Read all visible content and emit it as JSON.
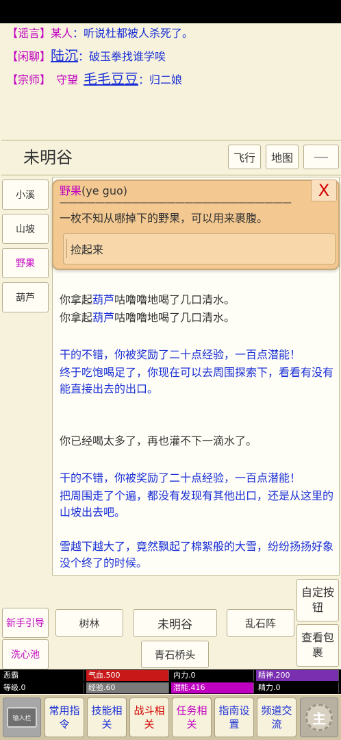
{
  "chat": [
    {
      "tag": "【谣言】",
      "speaker": "某人",
      "sep": "：",
      "message": "听说杜都被人杀死了。"
    },
    {
      "tag": "【闲聊】",
      "speaker": "陆沉",
      "sep": "：",
      "message": "破玉拳找谁学唉"
    },
    {
      "tag": "【宗师】",
      "title": "守望",
      "speaker": "毛毛豆豆",
      "sep": "：",
      "message": "归二娘"
    }
  ],
  "header": {
    "room_name": "未明谷",
    "fly_label": "飞行",
    "map_label": "地图",
    "minimize_symbol": "—"
  },
  "sidebar": {
    "items": [
      {
        "label": "小溪"
      },
      {
        "label": "山坡"
      },
      {
        "label": "野果"
      },
      {
        "label": "葫芦"
      }
    ],
    "bottom_items": [
      {
        "label": "新手引导"
      },
      {
        "label": "洗心池"
      }
    ]
  },
  "popup": {
    "item_name": "野果",
    "item_id": "(ye guo)",
    "rule": "——————————————————————————",
    "description": "一枚不知从哪掉下的野果，可以用来裹腹。",
    "close_label": "X",
    "action_label": "捡起来"
  },
  "log": [
    {
      "pre": "你拿起",
      "hl": "葫芦",
      "post": "咕噜噜地喝了几口清水。"
    },
    {
      "pre": "你拿起",
      "hl": "葫芦",
      "post": "咕噜噜地喝了几口清水。"
    },
    {
      "text": "干的不错，你被奖励了二十点经验，一百点潜能！"
    },
    {
      "text": "终于吃饱喝足了，你现在可以去周围探索下，看看有没有能直接出去的出口。"
    },
    {
      "text": "你已经喝太多了，再也灌不下一滴水了。"
    },
    {
      "text": "干的不错，你被奖励了二十点经验，一百点潜能！"
    },
    {
      "text": "把周围走了个遍，都没有发现有其他出口，还是从这里的山坡出去吧。"
    },
    {
      "text": "雪越下越大了，竟然飘起了棉絮般的大雪，纷纷扬扬好象没个终了的时候。"
    }
  ],
  "exits": {
    "west": "树林",
    "center": "未明谷",
    "east": "乱石阵",
    "south": "青石桥头"
  },
  "right_buttons": {
    "custom": "自定按钮",
    "inventory": "查看包裹"
  },
  "stats": {
    "row1": [
      {
        "label": "恶霸",
        "color": "#000000",
        "fill": 1.0
      },
      {
        "label": "气血.500",
        "color": "#c81818",
        "fill": 1.0
      },
      {
        "label": "内力.0",
        "color": "#000000",
        "fill": 0.0
      },
      {
        "label": "精神.200",
        "color": "#7a2fb0",
        "fill": 1.0
      }
    ],
    "row2": [
      {
        "label": "等级.0",
        "color": "#000000",
        "fill": 0.0
      },
      {
        "label": "经验.60",
        "color": "#7a7a7a",
        "fill": 1.0
      },
      {
        "label": "潜能.416",
        "color": "#c000c0",
        "fill": 1.0
      },
      {
        "label": "精力.0",
        "color": "#000000",
        "fill": 0.0
      }
    ]
  },
  "bottom_nav": {
    "input_label": "输入栏",
    "items": [
      {
        "label": "常用指令",
        "style": "blue"
      },
      {
        "label": "技能相关",
        "style": "blue"
      },
      {
        "label": "战斗相关",
        "style": "red"
      },
      {
        "label": "任务相关",
        "style": "pink"
      },
      {
        "label": "指南设置",
        "style": "blue"
      },
      {
        "label": "频道交流",
        "style": "blue"
      }
    ],
    "master_label": "主"
  }
}
